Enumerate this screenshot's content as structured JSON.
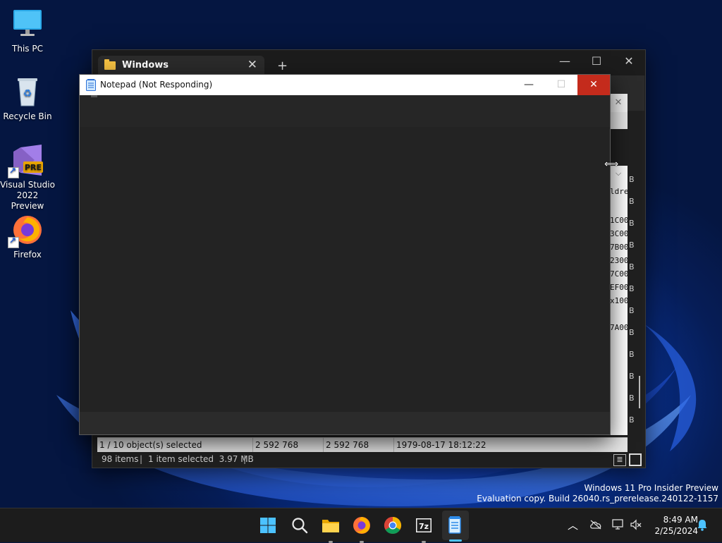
{
  "desktop": {
    "icons": [
      {
        "label": "This PC",
        "icon": "monitor-icon"
      },
      {
        "label": "Recycle Bin",
        "icon": "recycle-bin-icon"
      },
      {
        "label": "Visual Studio 2022 Preview",
        "badge": "PRE",
        "icon": "visual-studio-icon"
      },
      {
        "label": "Firefox",
        "icon": "firefox-icon"
      }
    ]
  },
  "back_window": {
    "tab_title": "Windows",
    "partial_column_header": "ldres",
    "partial_address_values": [
      "1C00",
      "3C00",
      "7B00",
      "2300",
      "7C00",
      "EF00",
      "x100",
      "",
      "7A00"
    ],
    "partial_size_suffix": "B",
    "inner_status": {
      "selected": "1 / 10 object(s) selected",
      "size": "2 592 768",
      "packed_size": "2 592 768",
      "modified": "1979-08-17 18:12:22"
    },
    "outer_status": {
      "items": "98 items",
      "selection": "1 item selected  3.97 MB"
    }
  },
  "notepad": {
    "title": "Notepad (Not Responding)"
  },
  "watermark": {
    "line1": "Windows 11 Pro Insider Preview",
    "line2": "Evaluation copy. Build 26040.rs_prerelease.240122-1157"
  },
  "taskbar": {
    "apps": [
      "windows-start-icon",
      "search-icon",
      "file-explorer-icon",
      "firefox-icon",
      "chrome-icon",
      "7zip-icon",
      "notepad-icon"
    ],
    "sevenzip_label": "7z",
    "clock": {
      "time": "8:49 AM",
      "date": "2/25/2024"
    }
  },
  "colors": {
    "accent": "#4cc2ff",
    "close_red": "#c42b1c",
    "folder_yellow": "#f5c142"
  }
}
